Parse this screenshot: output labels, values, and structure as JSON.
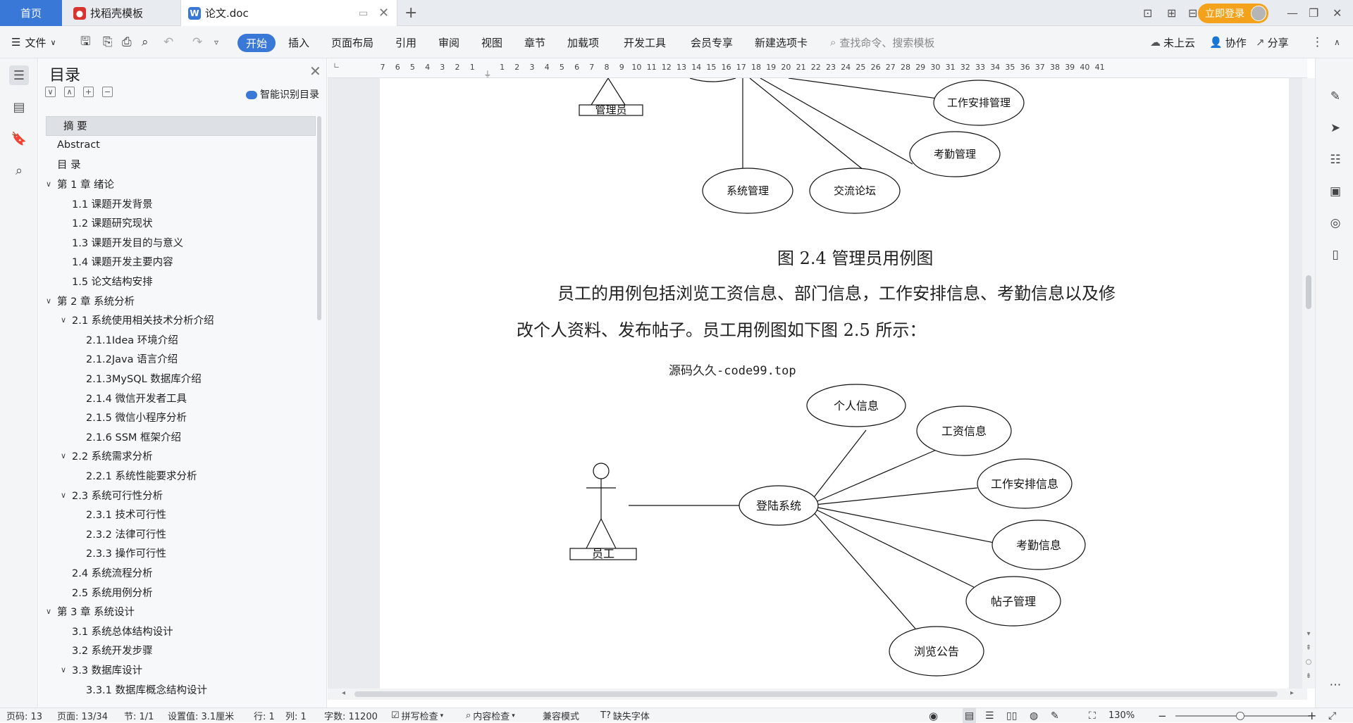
{
  "tabs": {
    "home": "首页",
    "templates": "找稻壳模板",
    "doc": "论文.doc"
  },
  "titlebar": {
    "login": "立即登录"
  },
  "toolbar": {
    "file": "文件",
    "menus": [
      "开始",
      "插入",
      "页面布局",
      "引用",
      "审阅",
      "视图",
      "章节",
      "加载项",
      "开发工具",
      "会员专享",
      "新建选项卡"
    ],
    "search_placeholder": "查找命令、搜索模板",
    "cloud": "未上云",
    "collab": "协作",
    "share": "分享"
  },
  "toc": {
    "title": "目录",
    "smart": "智能识别目录",
    "items": [
      {
        "label": "摘  要",
        "level": 0,
        "caret": ""
      },
      {
        "label": "Abstract",
        "level": 0,
        "caret": ""
      },
      {
        "label": "目  录",
        "level": 0,
        "caret": ""
      },
      {
        "label": "第 1 章   绪论",
        "level": 0,
        "caret": "∨"
      },
      {
        "label": "1.1 课题开发背景",
        "level": 1,
        "caret": ""
      },
      {
        "label": "1.2 课题研究现状",
        "level": 1,
        "caret": ""
      },
      {
        "label": "1.3 课题开发目的与意义",
        "level": 1,
        "caret": ""
      },
      {
        "label": "1.4 课题开发主要内容",
        "level": 1,
        "caret": ""
      },
      {
        "label": "1.5 论文结构安排",
        "level": 1,
        "caret": ""
      },
      {
        "label": "第 2 章  系统分析",
        "level": 0,
        "caret": "∨"
      },
      {
        "label": "2.1 系统使用相关技术分析介绍",
        "level": 1,
        "caret": "∨"
      },
      {
        "label": "2.1.1Idea 环境介绍",
        "level": 2,
        "caret": ""
      },
      {
        "label": "2.1.2Java 语言介绍",
        "level": 2,
        "caret": ""
      },
      {
        "label": " 2.1.3MySQL 数据库介绍",
        "level": 2,
        "caret": ""
      },
      {
        "label": "2.1.4 微信开发者工具",
        "level": 2,
        "caret": ""
      },
      {
        "label": "2.1.5 微信小程序分析",
        "level": 2,
        "caret": ""
      },
      {
        "label": "2.1.6 SSM 框架介绍",
        "level": 2,
        "caret": ""
      },
      {
        "label": "2.2 系统需求分析",
        "level": 1,
        "caret": "∨"
      },
      {
        "label": "2.2.1 系统性能要求分析",
        "level": 2,
        "caret": ""
      },
      {
        "label": "2.3 系统可行性分析",
        "level": 1,
        "caret": "∨"
      },
      {
        "label": "2.3.1 技术可行性",
        "level": 2,
        "caret": ""
      },
      {
        "label": "2.3.2 法律可行性",
        "level": 2,
        "caret": ""
      },
      {
        "label": "2.3.3 操作可行性",
        "level": 2,
        "caret": ""
      },
      {
        "label": "2.4 系统流程分析",
        "level": 1,
        "caret": ""
      },
      {
        "label": "2.5 系统用例分析",
        "level": 1,
        "caret": ""
      },
      {
        "label": "第 3 章  系统设计",
        "level": 0,
        "caret": "∨"
      },
      {
        "label": "3.1 系统总体结构设计",
        "level": 1,
        "caret": ""
      },
      {
        "label": "3.2 系统开发步骤",
        "level": 1,
        "caret": ""
      },
      {
        "label": "3.3 数据库设计",
        "level": 1,
        "caret": "∨"
      },
      {
        "label": "3.3.1 数据库概念结构设计",
        "level": 2,
        "caret": ""
      }
    ]
  },
  "ruler": {
    "numbers": [
      "7",
      "6",
      "5",
      "4",
      "3",
      "2",
      "1",
      "",
      "1",
      "2",
      "3",
      "4",
      "5",
      "6",
      "7",
      "8",
      "9",
      "10",
      "11",
      "12",
      "13",
      "14",
      "15",
      "16",
      "17",
      "18",
      "19",
      "20",
      "21",
      "22",
      "23",
      "24",
      "25",
      "26",
      "27",
      "28",
      "29",
      "30",
      "31",
      "32",
      "33",
      "34",
      "35",
      "36",
      "37",
      "38",
      "39",
      "40",
      "41"
    ]
  },
  "document": {
    "diagram1": {
      "actor": "管理员",
      "nodes": [
        "工作安排管理",
        "考勤管理",
        "系统管理",
        "交流论坛"
      ]
    },
    "caption1": "图 2.4 管理员用例图",
    "para_line1": "员工的用例包括浏览工资信息、部门信息，工作安排信息、考勤信息以及修",
    "para_line2": "改个人资料、发布帖子。员工用例图如下图 2.5 所示：",
    "watermark": "源码久久-code99.top",
    "diagram2": {
      "actor": "员工",
      "center": "登陆系统",
      "nodes": [
        "个人信息",
        "工资信息",
        "工作安排信息",
        "考勤信息",
        "帖子管理",
        "浏览公告"
      ]
    }
  },
  "status": {
    "page_num": "页码: 13",
    "page": "页面: 13/34",
    "section": "节: 1/1",
    "setting": "设置值: 3.1厘米",
    "row": "行: 1",
    "col": "列: 1",
    "words": "字数: 11200",
    "spell": "拼写检查",
    "content": "内容检查",
    "compat": "兼容模式",
    "font_missing": "缺失字体",
    "zoom": "130%"
  }
}
